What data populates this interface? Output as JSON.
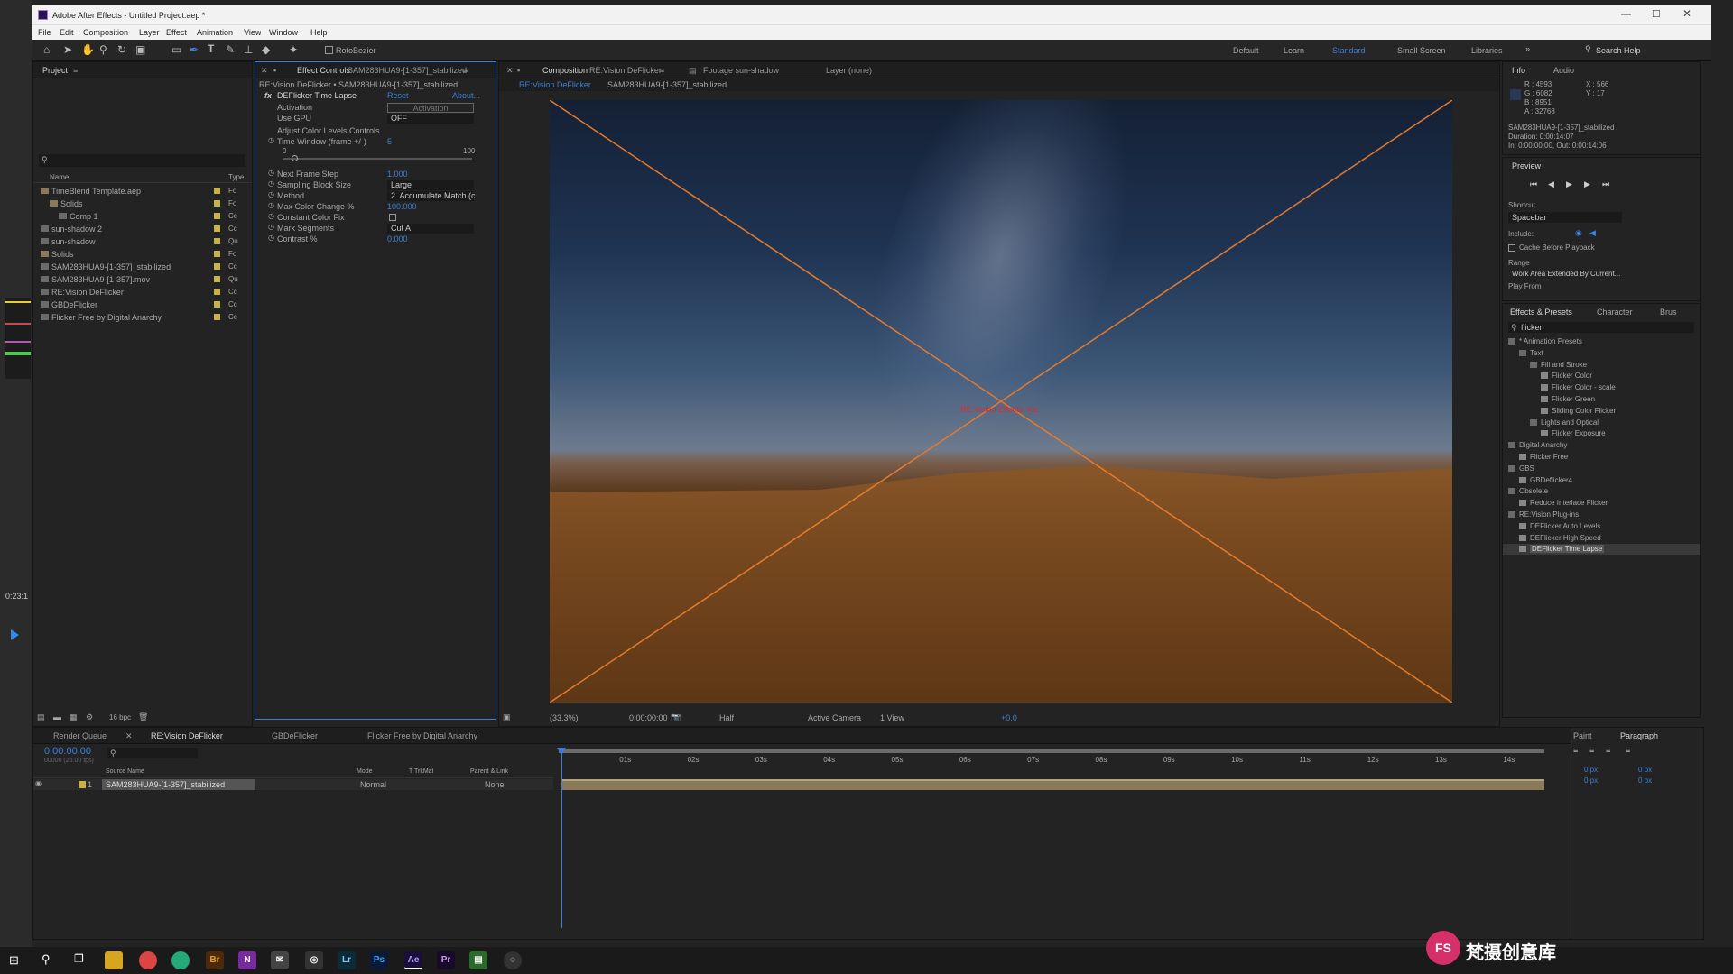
{
  "window": {
    "title": "Adobe After Effects - Untitled Project.aep *"
  },
  "menu": [
    "File",
    "Edit",
    "Composition",
    "Layer",
    "Effect",
    "Animation",
    "View",
    "Window",
    "Help"
  ],
  "toolbar": {
    "rotobezier": "RotoBezier",
    "workspaces": [
      "Default",
      "Learn",
      "Standard",
      "Small Screen",
      "Libraries"
    ],
    "search": "Search Help"
  },
  "project": {
    "title": "Project",
    "cols": {
      "name": "Name",
      "type": "Type"
    },
    "items": [
      {
        "name": "TimeBlend Template.aep",
        "type": "Fo",
        "color": "#c9b24a"
      },
      {
        "name": "Solids",
        "type": "Fo",
        "color": "#c9b24a"
      },
      {
        "name": "Comp 1",
        "type": "Cc",
        "color": "#c9b24a"
      },
      {
        "name": "sun-shadow 2",
        "type": "Cc",
        "color": "#c9b24a"
      },
      {
        "name": "sun-shadow",
        "type": "Qu",
        "color": "#c9b24a"
      },
      {
        "name": "Solids",
        "type": "Fo",
        "color": "#c9b24a"
      },
      {
        "name": "SAM283HUA9-[1-357]_stabilized",
        "type": "Cc",
        "color": "#c9b24a"
      },
      {
        "name": "SAM283HUA9-[1-357].mov",
        "type": "Qu",
        "color": "#c9b24a"
      },
      {
        "name": "RE:Vision DeFlicker",
        "type": "Cc",
        "color": "#c9b24a"
      },
      {
        "name": "GBDeFlicker",
        "type": "Cc",
        "color": "#c9b24a"
      },
      {
        "name": "Flicker Free by Digital Anarchy",
        "type": "Cc",
        "color": "#c9b24a"
      }
    ],
    "bpc": "16 bpc"
  },
  "effect_controls": {
    "tab": "Effect Controls",
    "tab_layer": "SAM283HUA9-[1-357]_stabilized",
    "breadcrumb": "RE:Vision DeFlicker • SAM283HUA9-[1-357]_stabilized",
    "effect_name": "DEFlicker Time Lapse",
    "reset": "Reset",
    "about": "About...",
    "params": [
      {
        "label": "Activation",
        "value": "Activation"
      },
      {
        "label": "Use GPU",
        "value": "OFF"
      },
      {
        "label": "Adjust Color Levels Controls",
        "value": ""
      },
      {
        "label": "Time Window (frame +/-)",
        "value": "5"
      },
      {
        "label": "Next Frame Step",
        "value": "1.000"
      },
      {
        "label": "Sampling Block Size",
        "value": "Large"
      },
      {
        "label": "Method",
        "value": "2. Accumulate Match (c"
      },
      {
        "label": "Max Color Change %",
        "value": "100.000"
      },
      {
        "label": "Constant Color Fix",
        "value": ""
      },
      {
        "label": "Mark Segments",
        "value": "Cut A"
      },
      {
        "label": "Contrast %",
        "value": "0.000"
      }
    ],
    "slider_min": "0",
    "slider_max": "100"
  },
  "composition": {
    "tab": "Composition",
    "tab_name": "RE:Vision DeFlicker",
    "footage_tab": "Footage sun-shadow",
    "layer_tab": "Layer (none)",
    "crumbs": [
      "RE:Vision DeFlicker",
      "SAM283HUA9-[1-357]_stabilized"
    ],
    "watermark": "RE:Vision Effects, Inc.",
    "footer": {
      "zoom": "(33.3%)",
      "time": "0:00:00:00",
      "res": "Half",
      "camera": "Active Camera",
      "views": "1 View",
      "exposure": "+0.0"
    }
  },
  "info": {
    "tabs": [
      "Info",
      "Audio"
    ],
    "rgba": [
      "R : 4593",
      "G : 6082",
      "B : 8951",
      "A : 32768"
    ],
    "xy": [
      "X : 566",
      "Y : 17"
    ],
    "layer": "SAM283HUA9-[1-357]_stabilized",
    "duration": "Duration: 0:00:14:07",
    "inout": "In: 0:00:00:00, Out: 0:00:14:06"
  },
  "preview": {
    "title": "Preview",
    "shortcut_label": "Shortcut",
    "shortcut": "Spacebar",
    "include": "Include:",
    "cache": "Cache Before Playback",
    "range_label": "Range",
    "range": "Work Area Extended By Current...",
    "play_from": "Play From"
  },
  "effects_presets": {
    "tabs": [
      "Effects & Presets",
      "Character",
      "Brus"
    ],
    "search": "flicker",
    "tree": [
      {
        "t": "* Animation Presets",
        "d": 0,
        "f": true
      },
      {
        "t": "Text",
        "d": 1,
        "f": true
      },
      {
        "t": "Fill and Stroke",
        "d": 2,
        "f": true
      },
      {
        "t": "Flicker Color",
        "d": 3
      },
      {
        "t": "Flicker Color - scale",
        "d": 3
      },
      {
        "t": "Flicker Green",
        "d": 3
      },
      {
        "t": "Sliding Color Flicker",
        "d": 3
      },
      {
        "t": "Lights and Optical",
        "d": 2,
        "f": true
      },
      {
        "t": "Flicker Exposure",
        "d": 3
      },
      {
        "t": "Digital Anarchy",
        "d": 0,
        "f": true
      },
      {
        "t": "Flicker Free",
        "d": 1
      },
      {
        "t": "GBS",
        "d": 0,
        "f": true
      },
      {
        "t": "GBDeflicker4",
        "d": 1
      },
      {
        "t": "Obsolete",
        "d": 0,
        "f": true
      },
      {
        "t": "Reduce Interlace Flicker",
        "d": 1
      },
      {
        "t": "RE:Vision Plug-ins",
        "d": 0,
        "f": true
      },
      {
        "t": "DEFlicker Auto Levels",
        "d": 1
      },
      {
        "t": "DEFlicker High Speed",
        "d": 1
      },
      {
        "t": "DEFlicker Time Lapse",
        "d": 1,
        "sel": true
      }
    ]
  },
  "timeline": {
    "tabs": [
      "Render Queue",
      "RE:Vision DeFlicker",
      "GBDeFlicker",
      "Flicker Free by Digital Anarchy"
    ],
    "timecode": "0:00:00:00",
    "fps": "00000 (25.00 fps)",
    "ruler": [
      "01s",
      "02s",
      "03s",
      "04s",
      "05s",
      "06s",
      "07s",
      "08s",
      "09s",
      "10s",
      "11s",
      "12s",
      "13s",
      "14s"
    ],
    "cols": {
      "source": "Source Name",
      "mode": "Mode",
      "trkmat": "T  TrkMat",
      "parent": "Parent & Link"
    },
    "layer": {
      "num": "1",
      "name": "SAM283HUA9-[1-357]_stabilized",
      "mode": "Normal",
      "parent": "None"
    }
  },
  "paragraph": {
    "tabs": [
      "Paint",
      "Paragraph"
    ],
    "px": [
      "0 px",
      "0 px",
      "0 px",
      "0 px",
      "0 px"
    ]
  },
  "side_timecode": "0:23:1",
  "brand": {
    "text": "梵摄创意库",
    "logo": "FS"
  }
}
